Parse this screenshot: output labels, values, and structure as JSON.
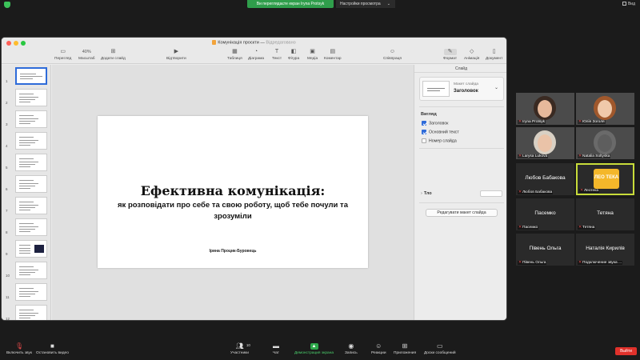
{
  "zoom": {
    "share_banner": "Ви переглядаєте екран Iryna Protsyk",
    "view_settings": "Настройки просмотра",
    "view_label": "Вид",
    "leave": "Выйти",
    "controls": {
      "unmute": "Включить звук",
      "stop_video": "Остановить видео",
      "participants": "Участники",
      "participants_count": "10",
      "chat": "Чат",
      "share_screen": "Демонстрация экрана",
      "record": "Запись",
      "reactions": "Реакции",
      "apps": "Приложения",
      "whiteboards": "Доски сообщений"
    },
    "accent_color": "#2f9e4b",
    "leave_color": "#e0312b"
  },
  "keynote": {
    "title": "Комунікація проєкти",
    "title_status": "Відредаговано",
    "toolbar": {
      "view": "Перегляд",
      "zoom_value": "40%",
      "zoom_label": "Масштаб",
      "add_slide": "Додати слайд",
      "play": "Відтворити",
      "table": "Таблиця",
      "chart": "Діаграма",
      "text": "Текст",
      "shape": "Фігура",
      "media": "Медіа",
      "comment": "Коментар",
      "collaborate": "Співпраця",
      "format": "Формат",
      "animate": "Анімація",
      "document": "Документ"
    },
    "slide_numbers": [
      "1",
      "2",
      "3",
      "4",
      "5",
      "6",
      "7",
      "8",
      "9",
      "10",
      "11",
      "12"
    ],
    "slide": {
      "title": "Ефективна комунікація:",
      "subtitle": "як розповідати про себе та свою роботу, щоб тебе почули та зрозуміли",
      "author": "Ірина Процик-Буровець"
    },
    "inspector": {
      "tab": "Слайд",
      "layout_caption": "Макет слайда",
      "layout_value": "Заголовок",
      "appearance": "Вигляд",
      "options": [
        {
          "label": "Заголовок",
          "checked": true
        },
        {
          "label": "Основний текст",
          "checked": true
        },
        {
          "label": "Номер слайда",
          "checked": false
        }
      ],
      "background": "Тло",
      "edit_layout": "Редагувати макет слайда"
    }
  },
  "participants": [
    {
      "name": "Iryna Protsyk",
      "type": "video"
    },
    {
      "name": "Юлія Зоголя",
      "type": "video"
    },
    {
      "name": "Larysa Lukova",
      "type": "video"
    },
    {
      "name": "Natalia Soltyska",
      "type": "video"
    },
    {
      "name": "Любов Бабакова",
      "display": "Любов Бабакова",
      "type": "name"
    },
    {
      "name": "Леотека",
      "type": "logo",
      "logo_text": "ЛЕО ТЕКА"
    },
    {
      "name": "Пасемко",
      "display": "Пасемко",
      "type": "name"
    },
    {
      "name": "Тетяна",
      "display": "Тетяна",
      "type": "name"
    },
    {
      "name": "Півень Ольга",
      "display": "Півень Ольга",
      "type": "name"
    },
    {
      "name": "Подключение звука ...",
      "display": "Наталія Кирилів",
      "type": "name"
    }
  ]
}
